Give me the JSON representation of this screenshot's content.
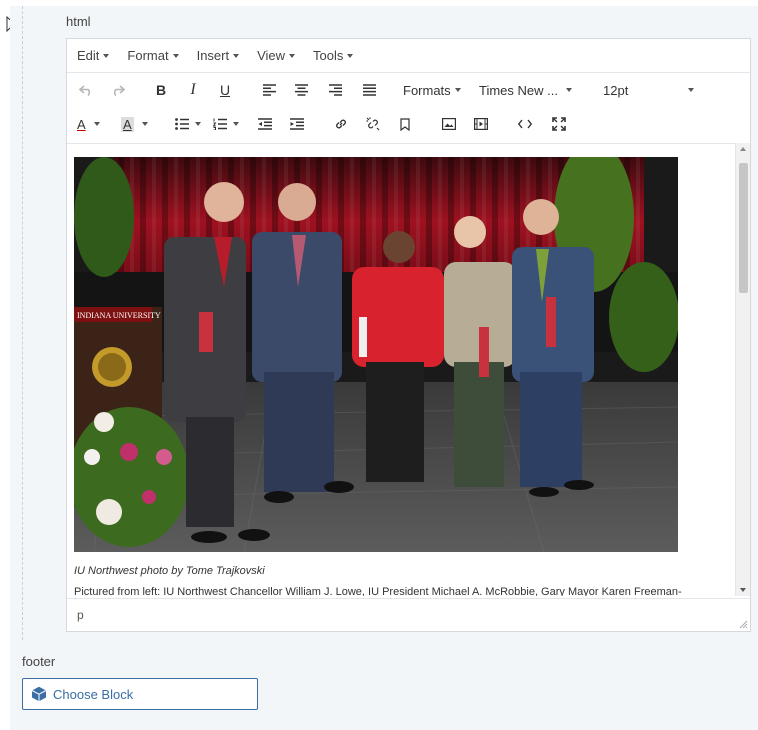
{
  "fields": {
    "html_label": "html",
    "footer_label": "footer"
  },
  "menubar": [
    {
      "label": "Edit"
    },
    {
      "label": "Format"
    },
    {
      "label": "Insert"
    },
    {
      "label": "View"
    },
    {
      "label": "Tools"
    }
  ],
  "toolbar": {
    "bold": "B",
    "italic": "I",
    "underline": "U",
    "formats": "Formats",
    "font_family": "Times New ...",
    "font_size": "12pt",
    "text_color": "A",
    "bg_color": "A"
  },
  "content": {
    "photo_banner": "INDIANA UNIVERSITY",
    "caption": "IU Northwest photo by Tome Trajkovski",
    "description": "Pictured from left: IU Northwest Chancellor William J. Lowe, IU President Michael A. McRobbie, Gary Mayor Karen Freeman-"
  },
  "statusbar": {
    "path": "p"
  },
  "footer": {
    "choose_block": "Choose Block"
  },
  "colors": {
    "accent": "#3a6ea5",
    "panel_bg": "#f3f6f9",
    "curtain": "#9e1120"
  }
}
